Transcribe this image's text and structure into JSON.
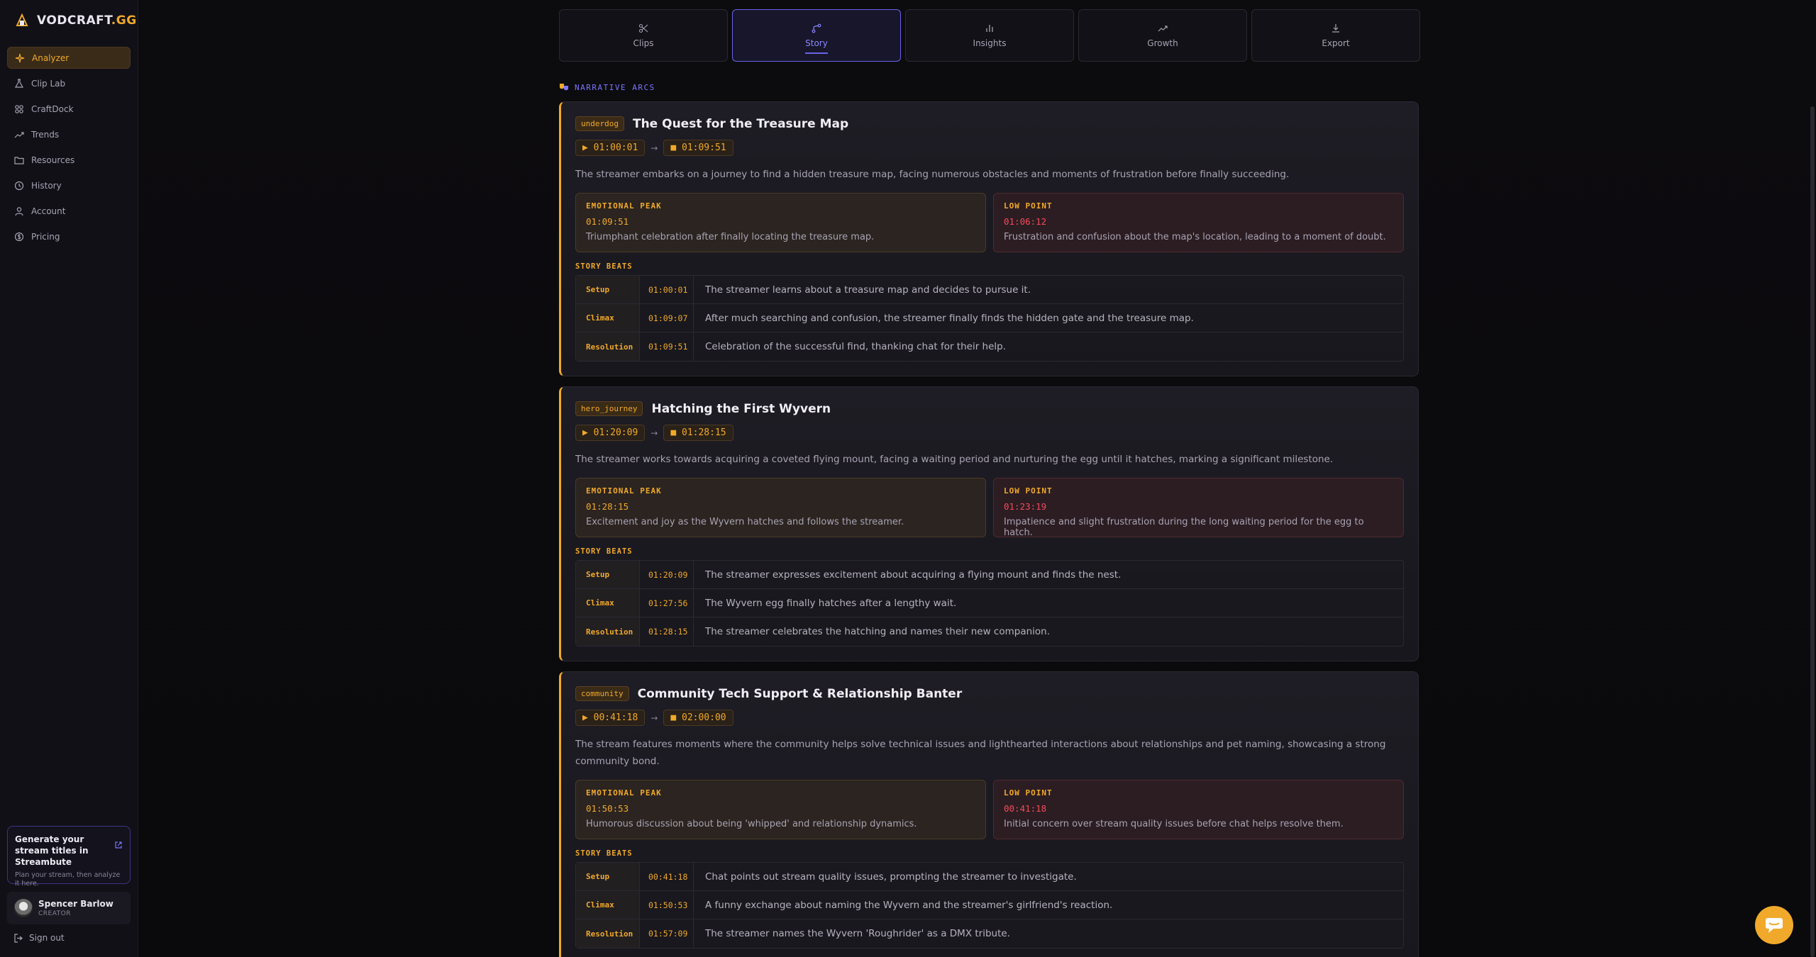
{
  "brand": {
    "name_main": "VODCRAFT",
    "name_suffix": ".GG"
  },
  "sidebar": {
    "items": [
      {
        "label": "Analyzer",
        "icon": "sparkle-icon"
      },
      {
        "label": "Clip Lab",
        "icon": "flask-icon"
      },
      {
        "label": "CraftDock",
        "icon": "grid-icon"
      },
      {
        "label": "Trends",
        "icon": "trend-icon"
      },
      {
        "label": "Resources",
        "icon": "folder-icon"
      },
      {
        "label": "History",
        "icon": "clock-icon"
      },
      {
        "label": "Account",
        "icon": "user-icon"
      },
      {
        "label": "Pricing",
        "icon": "coin-icon"
      }
    ],
    "promo": {
      "title": "Generate your stream titles in Streambute",
      "subtitle": "Plan your stream, then analyze it here."
    },
    "user": {
      "name": "Spencer Barlow",
      "role": "CREATOR"
    },
    "signout": "Sign out"
  },
  "tabs": [
    {
      "label": "Clips",
      "icon": "scissors-icon"
    },
    {
      "label": "Story",
      "icon": "route-icon"
    },
    {
      "label": "Insights",
      "icon": "bars-icon"
    },
    {
      "label": "Growth",
      "icon": "trend-icon"
    },
    {
      "label": "Export",
      "icon": "download-icon"
    }
  ],
  "section_label": "NARRATIVE ARCS",
  "labels": {
    "peak": "EMOTIONAL PEAK",
    "low": "LOW POINT",
    "beats": "STORY BEATS"
  },
  "arcs": [
    {
      "tag": "underdog",
      "title": "The Quest for the Treasure Map",
      "start": "▶ 01:00:01",
      "end": "■ 01:09:51",
      "summary": "The streamer embarks on a journey to find a hidden treasure map, facing numerous obstacles and moments of frustration before finally succeeding.",
      "peak_time": "01:09:51",
      "peak_desc": "Triumphant celebration after finally locating the treasure map.",
      "low_time": "01:06:12",
      "low_desc": "Frustration and confusion about the map's location, leading to a moment of doubt.",
      "beats": [
        {
          "type": "Setup",
          "time": "01:00:01",
          "desc": "The streamer learns about a treasure map and decides to pursue it."
        },
        {
          "type": "Climax",
          "time": "01:09:07",
          "desc": "After much searching and confusion, the streamer finally finds the hidden gate and the treasure map."
        },
        {
          "type": "Resolution",
          "time": "01:09:51",
          "desc": "Celebration of the successful find, thanking chat for their help."
        }
      ]
    },
    {
      "tag": "hero_journey",
      "title": "Hatching the First Wyvern",
      "start": "▶ 01:20:09",
      "end": "■ 01:28:15",
      "summary": "The streamer works towards acquiring a coveted flying mount, facing a waiting period and nurturing the egg until it hatches, marking a significant milestone.",
      "peak_time": "01:28:15",
      "peak_desc": "Excitement and joy as the Wyvern hatches and follows the streamer.",
      "low_time": "01:23:19",
      "low_desc": "Impatience and slight frustration during the long waiting period for the egg to hatch.",
      "beats": [
        {
          "type": "Setup",
          "time": "01:20:09",
          "desc": "The streamer expresses excitement about acquiring a flying mount and finds the nest."
        },
        {
          "type": "Climax",
          "time": "01:27:56",
          "desc": "The Wyvern egg finally hatches after a lengthy wait."
        },
        {
          "type": "Resolution",
          "time": "01:28:15",
          "desc": "The streamer celebrates the hatching and names their new companion."
        }
      ]
    },
    {
      "tag": "community",
      "title": "Community Tech Support & Relationship Banter",
      "start": "▶ 00:41:18",
      "end": "■ 02:00:00",
      "summary": "The stream features moments where the community helps solve technical issues and lighthearted interactions about relationships and pet naming, showcasing a strong community bond.",
      "peak_time": "01:50:53",
      "peak_desc": "Humorous discussion about being 'whipped' and relationship dynamics.",
      "low_time": "00:41:18",
      "low_desc": "Initial concern over stream quality issues before chat helps resolve them.",
      "beats": [
        {
          "type": "Setup",
          "time": "00:41:18",
          "desc": "Chat points out stream quality issues, prompting the streamer to investigate."
        },
        {
          "type": "Climax",
          "time": "01:50:53",
          "desc": "A funny exchange about naming the Wyvern and the streamer's girlfriend's reaction."
        },
        {
          "type": "Resolution",
          "time": "01:57:09",
          "desc": "The streamer names the Wyvern 'Roughrider' as a DMX tribute."
        }
      ]
    }
  ]
}
